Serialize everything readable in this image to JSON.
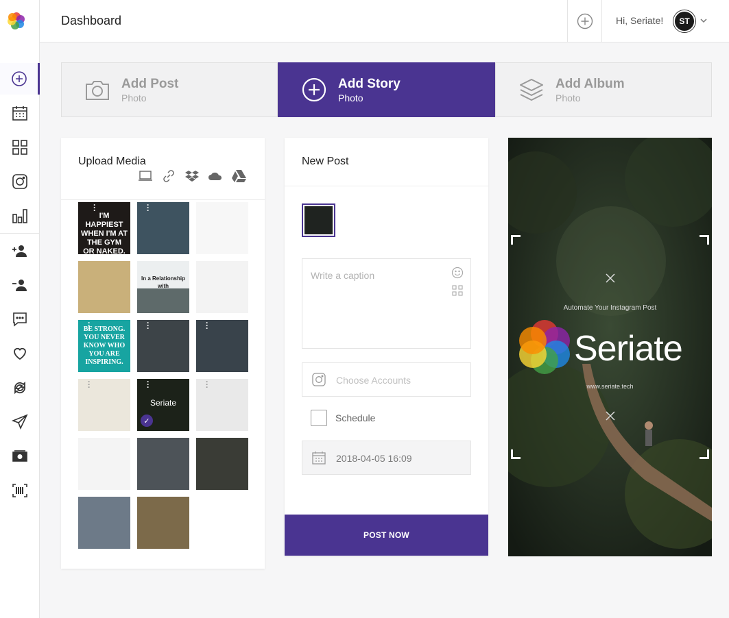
{
  "header": {
    "title": "Dashboard",
    "greeting": "Hi, Seriate!",
    "avatar_initials": "ST"
  },
  "sidebar": {
    "items": [
      {
        "icon": "add-circle-icon",
        "active": true
      },
      {
        "icon": "calendar-icon"
      },
      {
        "icon": "grid-icon"
      },
      {
        "icon": "instagram-icon"
      },
      {
        "icon": "bar-chart-icon"
      },
      {
        "icon": "add-user-icon"
      },
      {
        "icon": "remove-user-icon"
      },
      {
        "icon": "comment-icon"
      },
      {
        "icon": "heart-icon"
      },
      {
        "icon": "repost-icon"
      },
      {
        "icon": "send-icon"
      },
      {
        "icon": "money-icon"
      },
      {
        "icon": "barcode-icon"
      }
    ]
  },
  "tabs": [
    {
      "title": "Add Post",
      "subtitle": "Photo",
      "icon": "camera-icon",
      "active": false
    },
    {
      "title": "Add Story",
      "subtitle": "Photo",
      "icon": "plus-circle-icon",
      "active": true
    },
    {
      "title": "Add Album",
      "subtitle": "Photo",
      "icon": "layers-icon",
      "active": false
    }
  ],
  "upload": {
    "title": "Upload Media",
    "sources": [
      "laptop-icon",
      "link-icon",
      "dropbox-icon",
      "onedrive-icon",
      "google-drive-icon"
    ],
    "thumbs": [
      {
        "text": "I'M HAPPIEST WHEN I'M AT THE GYM OR NAKED.",
        "bg": "#1e1a18"
      },
      {
        "text": "",
        "bg": "#3e5360"
      },
      {
        "text": "",
        "bg": "#f7f7f7"
      },
      {
        "text": "",
        "bg": "#c9b07a"
      },
      {
        "text": "In a Relationship with",
        "bg": "#eceff0"
      },
      {
        "text": "",
        "bg": "#f3f3f3"
      },
      {
        "text": "BE STRONG. YOU NEVER KNOW WHO YOU ARE INSPIRING.",
        "bg": "#17a4a1"
      },
      {
        "text": "",
        "bg": "#3d4448"
      },
      {
        "text": "",
        "bg": "#39434b"
      },
      {
        "text": "",
        "bg": "#ebe7dc"
      },
      {
        "text": "Seriate",
        "bg": "#1c2219",
        "selected": true
      },
      {
        "text": "",
        "bg": "#e9e9e9"
      },
      {
        "text": "",
        "bg": "#f4f4f4"
      },
      {
        "text": "",
        "bg": "#4d5358"
      },
      {
        "text": "",
        "bg": "#3a3c36"
      },
      {
        "text": "",
        "bg": "#6d7a88"
      },
      {
        "text": "",
        "bg": "#7c6a4a"
      }
    ]
  },
  "newpost": {
    "title": "New Post",
    "caption_placeholder": "Write a caption",
    "accounts_placeholder": "Choose Accounts",
    "schedule_label": "Schedule",
    "date_value": "2018-04-05 16:09",
    "post_button": "POST NOW"
  },
  "preview": {
    "tagline": "Automate  Your Instagram Post",
    "brand": "Seriate",
    "url": "www.seriate.tech"
  },
  "colors": {
    "accent": "#4a3491"
  }
}
